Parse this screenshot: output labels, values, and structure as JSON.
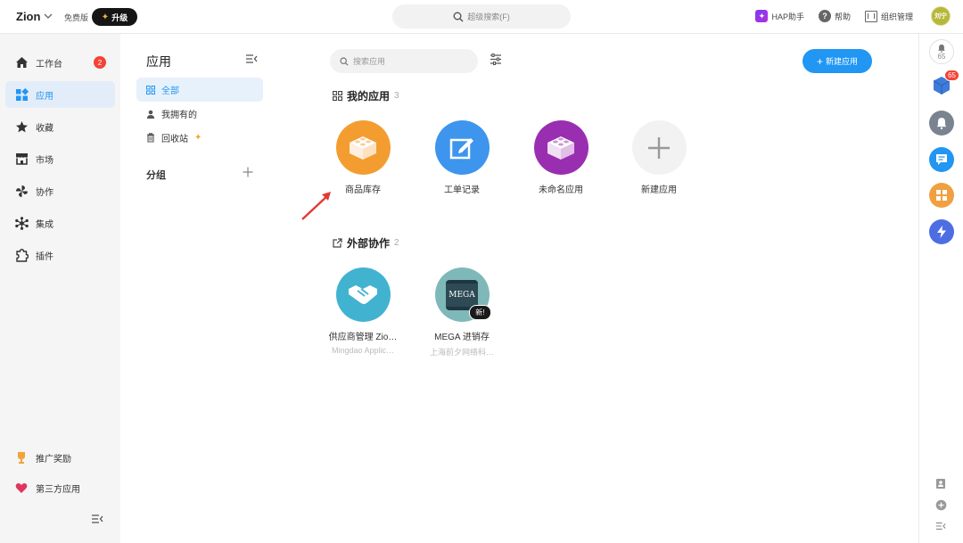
{
  "topbar": {
    "brand": "Zion",
    "edition": "免费版",
    "upgrade_label": "升级",
    "search_label": "超级搜索(F)",
    "hap_label": "HAP助手",
    "help_label": "帮助",
    "org_label": "组织管理",
    "user_avatar": "刘宁"
  },
  "leftnav": {
    "items": [
      {
        "label": "工作台",
        "icon": "home-icon",
        "badge": "2"
      },
      {
        "label": "应用",
        "icon": "apps-icon"
      },
      {
        "label": "收藏",
        "icon": "star-icon"
      },
      {
        "label": "市场",
        "icon": "store-icon"
      },
      {
        "label": "协作",
        "icon": "pinwheel-icon"
      },
      {
        "label": "集成",
        "icon": "integration-icon"
      },
      {
        "label": "插件",
        "icon": "plugin-icon"
      }
    ],
    "bottom_items": [
      {
        "label": "推广奖励",
        "icon": "trophy-icon"
      },
      {
        "label": "第三方应用",
        "icon": "heart-icon"
      }
    ]
  },
  "groups": {
    "title": "应用",
    "items": [
      {
        "label": "全部",
        "icon": "grid-icon"
      },
      {
        "label": "我拥有的",
        "icon": "person-icon"
      },
      {
        "label": "回收站",
        "icon": "trash-icon"
      }
    ],
    "section_label": "分组"
  },
  "main": {
    "search_placeholder": "搜索应用",
    "new_app_label": "新建应用",
    "my_apps": {
      "title": "我的应用",
      "count": "3",
      "apps": [
        {
          "name": "商品库存",
          "color": "#f39d31",
          "icon": "bricks-icon"
        },
        {
          "name": "工单记录",
          "color": "#3d95ee",
          "icon": "edit-icon"
        },
        {
          "name": "未命名应用",
          "color": "#9a2eb0",
          "icon": "bricks-icon"
        },
        {
          "name": "新建应用",
          "color": "#f2f2f2",
          "icon": "plus-icon"
        }
      ]
    },
    "external": {
      "title": "外部协作",
      "count": "2",
      "apps": [
        {
          "name": "供应商管理 Zio…",
          "sub": "Mingdao Applic…",
          "color": "#41b3d0",
          "icon": "handshake-icon"
        },
        {
          "name": "MEGA 进销存",
          "sub": "上海前夕网络科…",
          "color": "#7fb8b8",
          "icon": "mega-logo",
          "tag": "新!",
          "logo_text": "MEGA"
        }
      ]
    }
  },
  "rightbar": {
    "notify_count": "65",
    "badge_count": "65"
  }
}
